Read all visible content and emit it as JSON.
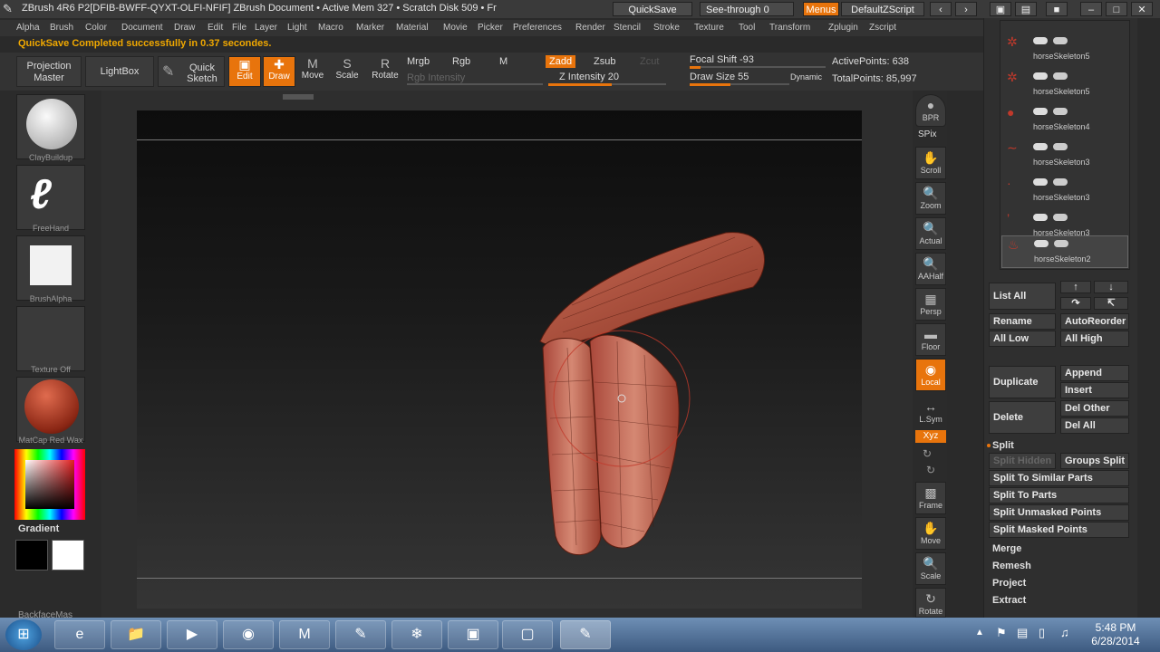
{
  "title_bar": {
    "title": "ZBrush 4R6  P2[DFIB-BWFF-QYXT-OLFI-NFIF]   ZBrush Document     • Active Mem 327 • Scratch Disk 509 • Fr",
    "quicksave": "QuickSave",
    "see_through": "See-through   0",
    "menus": "Menus",
    "default_zscript": "DefaultZScript"
  },
  "menu_items": [
    "Alpha",
    "Brush",
    "Color",
    "Document",
    "Draw",
    "Edit",
    "File",
    "Layer",
    "Light",
    "Macro",
    "Marker",
    "Material",
    "Movie",
    "Picker",
    "Preferences",
    "Render",
    "Stencil",
    "Stroke",
    "Texture",
    "Tool",
    "Transform",
    "Zplugin",
    "Zscript"
  ],
  "notice": "QuickSave Completed successfully in 0.37 secondes.",
  "toolbar": {
    "projection_master": "Projection Master",
    "lightbox": "LightBox",
    "quick_sketch": "Quick Sketch",
    "edit": "Edit",
    "draw": "Draw",
    "move": "Move",
    "scale": "Scale",
    "rotate": "Rotate",
    "mrgb": "Mrgb",
    "rgb": "Rgb",
    "m": "M",
    "rgb_intensity": "Rgb Intensity",
    "zadd": "Zadd",
    "zsub": "Zsub",
    "zcut": "Zcut",
    "z_intensity": "Z Intensity 20",
    "focal_shift": "Focal Shift -93",
    "draw_size": "Draw Size 55",
    "dynamic": "Dynamic",
    "active_points": "ActivePoints: 638",
    "total_points": "TotalPoints: 85,997"
  },
  "left_shelf": {
    "brush": "ClayBuildup",
    "stroke": "FreeHand",
    "alpha": "BrushAlpha",
    "texture": "Texture Off",
    "material": "MatCap Red Wax",
    "gradient": "Gradient",
    "bottom_label": "BackfaceMas"
  },
  "right_shelf": [
    "BPR",
    "SPix",
    "Scroll",
    "Zoom",
    "Actual",
    "AAHalf",
    "Persp",
    "Floor",
    "Local",
    "L.Sym",
    "Xyz",
    "Frame",
    "Move",
    "Scale",
    "Rotate"
  ],
  "subtools": [
    "horseSkeleton5",
    "horseSkeleton5",
    "horseSkeleton4",
    "horseSkeleton3",
    "horseSkeleton3",
    "horseSkeleton3",
    "horseSkeleton2"
  ],
  "subtool_panel": {
    "list_all": "List All",
    "rename": "Rename",
    "auto_reorder": "AutoReorder",
    "all_low": "All Low",
    "all_high": "All High",
    "duplicate": "Duplicate",
    "append": "Append",
    "insert": "Insert",
    "delete": "Delete",
    "del_other": "Del Other",
    "del_all": "Del All",
    "split": "Split",
    "split_hidden": "Split Hidden",
    "groups_split": "Groups Split",
    "split_similar": "Split To Similar Parts",
    "split_parts": "Split To Parts",
    "split_unmasked": "Split Unmasked Points",
    "split_masked": "Split Masked Points",
    "merge": "Merge",
    "remesh": "Remesh",
    "project": "Project",
    "extract": "Extract"
  },
  "clock": {
    "time": "5:48 PM",
    "date": "6/28/2014"
  },
  "colors": {
    "accent": "#e8740c",
    "model": "#b0503c"
  }
}
